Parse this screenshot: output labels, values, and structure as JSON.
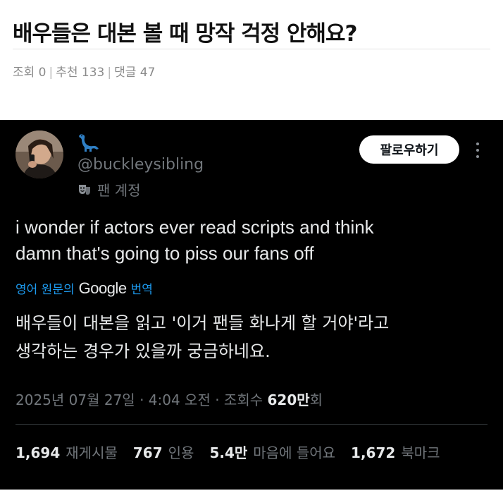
{
  "post": {
    "title": "배우들은 대본 볼 때 망작 걱정 안해요?",
    "meta": {
      "views": "조회 0",
      "recommends": "추천 133",
      "comments": "댓글 47"
    }
  },
  "tweet": {
    "handle": "@buckleysibling",
    "fan_label": "팬 계정",
    "follow_label": "팔로우하기",
    "text_line1": "i wonder if actors ever read scripts and think",
    "text_line2": "damn that's going to piss our fans off",
    "translate_prefix": "영어 원문의",
    "translate_brand": "Google",
    "translate_suffix": "번역",
    "translated_line1": "배우들이 대본을 읽고 '이거 팬들 화나게 할 거야'라고",
    "translated_line2": "생각하는 경우가 있을까 궁금하네요.",
    "timestamp": "2025년 07월 27일 · 4:04 오전 · 조회수 ",
    "views_count": "620만",
    "views_suffix": "회",
    "stats": {
      "retweets_num": "1,694",
      "retweets_label": "재게시물",
      "quotes_num": "767",
      "quotes_label": "인용",
      "likes_num": "5.4만",
      "likes_label": "마음에 들어요",
      "bookmarks_num": "1,672",
      "bookmarks_label": "북마크"
    },
    "icons": {
      "display_name": "dinosaur-emoji",
      "fan_badge": "theater-masks"
    }
  },
  "colors": {
    "tweet_bg": "#000000",
    "text_primary": "#e7e9ea",
    "text_secondary": "#71767b",
    "link_blue": "#1d9bf0"
  }
}
